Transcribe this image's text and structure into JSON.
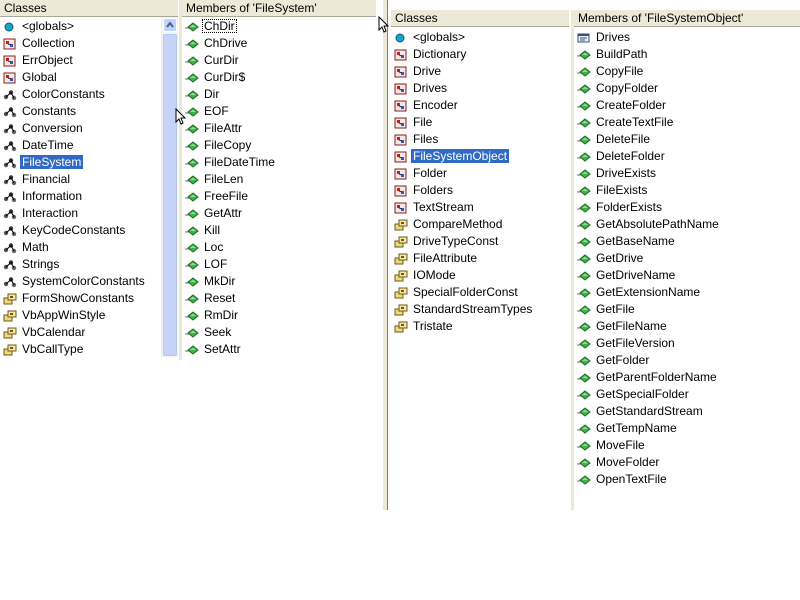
{
  "left": {
    "classes_header": "Classes",
    "members_header": "Members of 'FileSystem'",
    "classes": [
      {
        "label": "<globals>",
        "icon": "globals-icon"
      },
      {
        "label": "Collection",
        "icon": "class-icon"
      },
      {
        "label": "ErrObject",
        "icon": "class-icon"
      },
      {
        "label": "Global",
        "icon": "class-icon"
      },
      {
        "label": "ColorConstants",
        "icon": "module-icon"
      },
      {
        "label": "Constants",
        "icon": "module-icon"
      },
      {
        "label": "Conversion",
        "icon": "module-icon"
      },
      {
        "label": "DateTime",
        "icon": "module-icon"
      },
      {
        "label": "FileSystem",
        "icon": "module-icon",
        "selected": true
      },
      {
        "label": "Financial",
        "icon": "module-icon"
      },
      {
        "label": "Information",
        "icon": "module-icon"
      },
      {
        "label": "Interaction",
        "icon": "module-icon"
      },
      {
        "label": "KeyCodeConstants",
        "icon": "module-icon"
      },
      {
        "label": "Math",
        "icon": "module-icon"
      },
      {
        "label": "Strings",
        "icon": "module-icon"
      },
      {
        "label": "SystemColorConstants",
        "icon": "module-icon"
      },
      {
        "label": "FormShowConstants",
        "icon": "enum-icon"
      },
      {
        "label": "VbAppWinStyle",
        "icon": "enum-icon"
      },
      {
        "label": "VbCalendar",
        "icon": "enum-icon"
      },
      {
        "label": "VbCallType",
        "icon": "enum-icon"
      }
    ],
    "members": [
      "ChDir",
      "ChDrive",
      "CurDir",
      "CurDir$",
      "Dir",
      "EOF",
      "FileAttr",
      "FileCopy",
      "FileDateTime",
      "FileLen",
      "FreeFile",
      "GetAttr",
      "Kill",
      "Loc",
      "LOF",
      "MkDir",
      "Reset",
      "RmDir",
      "Seek",
      "SetAttr"
    ]
  },
  "right": {
    "classes_header": "Classes",
    "members_header": "Members of 'FileSystemObject'",
    "classes": [
      {
        "label": "<globals>",
        "icon": "globals-icon"
      },
      {
        "label": "Dictionary",
        "icon": "class-icon"
      },
      {
        "label": "Drive",
        "icon": "class-icon"
      },
      {
        "label": "Drives",
        "icon": "class-icon"
      },
      {
        "label": "Encoder",
        "icon": "class-icon"
      },
      {
        "label": "File",
        "icon": "class-icon"
      },
      {
        "label": "Files",
        "icon": "class-icon"
      },
      {
        "label": "FileSystemObject",
        "icon": "class-icon",
        "selected": true
      },
      {
        "label": "Folder",
        "icon": "class-icon"
      },
      {
        "label": "Folders",
        "icon": "class-icon"
      },
      {
        "label": "TextStream",
        "icon": "class-icon"
      },
      {
        "label": "CompareMethod",
        "icon": "enum-icon"
      },
      {
        "label": "DriveTypeConst",
        "icon": "enum-icon"
      },
      {
        "label": "FileAttribute",
        "icon": "enum-icon"
      },
      {
        "label": "IOMode",
        "icon": "enum-icon"
      },
      {
        "label": "SpecialFolderConst",
        "icon": "enum-icon"
      },
      {
        "label": "StandardStreamTypes",
        "icon": "enum-icon"
      },
      {
        "label": "Tristate",
        "icon": "enum-icon"
      }
    ],
    "members": [
      {
        "label": "Drives",
        "icon": "property-icon"
      },
      {
        "label": "BuildPath",
        "icon": "method-icon"
      },
      {
        "label": "CopyFile",
        "icon": "method-icon"
      },
      {
        "label": "CopyFolder",
        "icon": "method-icon"
      },
      {
        "label": "CreateFolder",
        "icon": "method-icon"
      },
      {
        "label": "CreateTextFile",
        "icon": "method-icon"
      },
      {
        "label": "DeleteFile",
        "icon": "method-icon"
      },
      {
        "label": "DeleteFolder",
        "icon": "method-icon"
      },
      {
        "label": "DriveExists",
        "icon": "method-icon"
      },
      {
        "label": "FileExists",
        "icon": "method-icon"
      },
      {
        "label": "FolderExists",
        "icon": "method-icon"
      },
      {
        "label": "GetAbsolutePathName",
        "icon": "method-icon"
      },
      {
        "label": "GetBaseName",
        "icon": "method-icon"
      },
      {
        "label": "GetDrive",
        "icon": "method-icon"
      },
      {
        "label": "GetDriveName",
        "icon": "method-icon"
      },
      {
        "label": "GetExtensionName",
        "icon": "method-icon"
      },
      {
        "label": "GetFile",
        "icon": "method-icon"
      },
      {
        "label": "GetFileName",
        "icon": "method-icon"
      },
      {
        "label": "GetFileVersion",
        "icon": "method-icon"
      },
      {
        "label": "GetFolder",
        "icon": "method-icon"
      },
      {
        "label": "GetParentFolderName",
        "icon": "method-icon"
      },
      {
        "label": "GetSpecialFolder",
        "icon": "method-icon"
      },
      {
        "label": "GetStandardStream",
        "icon": "method-icon"
      },
      {
        "label": "GetTempName",
        "icon": "method-icon"
      },
      {
        "label": "MoveFile",
        "icon": "method-icon"
      },
      {
        "label": "MoveFolder",
        "icon": "method-icon"
      },
      {
        "label": "OpenTextFile",
        "icon": "method-icon"
      }
    ]
  },
  "colors": {
    "selection": "#316ac5",
    "header": "#ece9d8"
  }
}
